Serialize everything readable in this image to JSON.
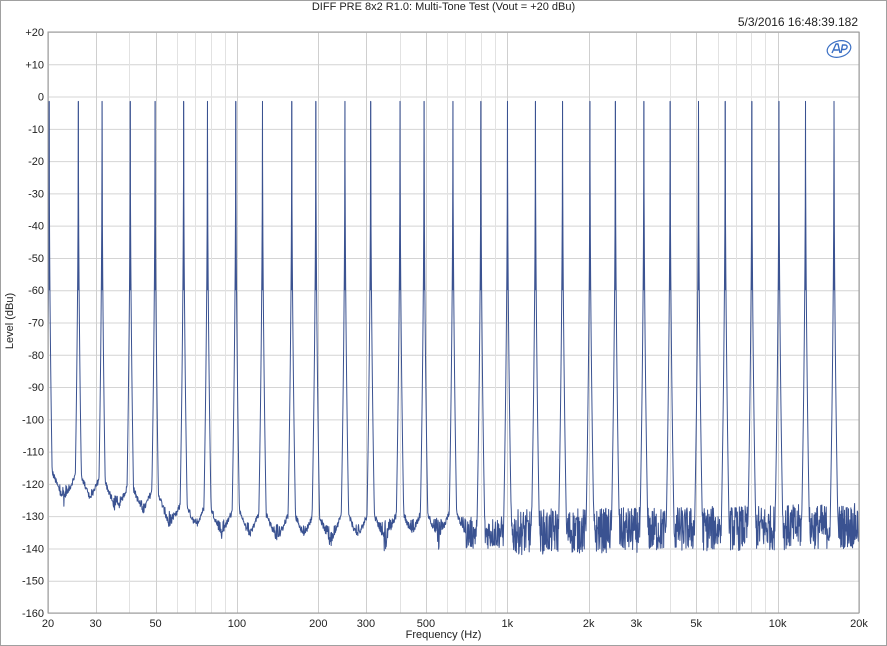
{
  "chart_data": {
    "type": "line",
    "title": "DIFF PRE 8x2 R1.0: Multi-Tone Test (Vout = +20 dBu)",
    "timestamp": "5/3/2016 16:48:39.182",
    "xlabel": "Frequency (Hz)",
    "ylabel": "Level (dBu)",
    "xscale": "log",
    "xlim": [
      20,
      20000
    ],
    "ylim": [
      -160,
      20
    ],
    "grid": true,
    "line_color": "#3a5291",
    "x_ticks": [
      {
        "value": 20,
        "label": "20"
      },
      {
        "value": 30,
        "label": "30"
      },
      {
        "value": 50,
        "label": "50"
      },
      {
        "value": 100,
        "label": "100"
      },
      {
        "value": 200,
        "label": "200"
      },
      {
        "value": 300,
        "label": "300"
      },
      {
        "value": 500,
        "label": "500"
      },
      {
        "value": 1000,
        "label": "1k"
      },
      {
        "value": 2000,
        "label": "2k"
      },
      {
        "value": 3000,
        "label": "3k"
      },
      {
        "value": 5000,
        "label": "5k"
      },
      {
        "value": 10000,
        "label": "10k"
      },
      {
        "value": 20000,
        "label": "20k"
      }
    ],
    "y_ticks": [
      {
        "value": 20,
        "label": "+20"
      },
      {
        "value": 10,
        "label": "+10"
      },
      {
        "value": 0,
        "label": "0"
      },
      {
        "value": -10,
        "label": "-10"
      },
      {
        "value": -20,
        "label": "-20"
      },
      {
        "value": -30,
        "label": "-30"
      },
      {
        "value": -40,
        "label": "-40"
      },
      {
        "value": -50,
        "label": "-50"
      },
      {
        "value": -60,
        "label": "-60"
      },
      {
        "value": -70,
        "label": "-70"
      },
      {
        "value": -80,
        "label": "-80"
      },
      {
        "value": -90,
        "label": "-90"
      },
      {
        "value": -100,
        "label": "-100"
      },
      {
        "value": -110,
        "label": "-110"
      },
      {
        "value": -120,
        "label": "-120"
      },
      {
        "value": -130,
        "label": "-130"
      },
      {
        "value": -140,
        "label": "-140"
      },
      {
        "value": -150,
        "label": "-150"
      },
      {
        "value": -160,
        "label": "-160"
      }
    ],
    "tones_hz": [
      20.2,
      25.9,
      31.7,
      40.3,
      49.8,
      63.5,
      77.8,
      99.0,
      124.3,
      159.5,
      195.8,
      250.9,
      312.4,
      401.1,
      492.3,
      629.5,
      798.5,
      1001.7,
      1271,
      1601,
      2022,
      2511,
      3201,
      4003,
      5097,
      6399,
      8029,
      10113,
      12681,
      16166
    ],
    "tone_level_dbu": -1.5,
    "noise_floor": [
      {
        "x": 20.5,
        "y": -123
      },
      {
        "x": 25,
        "y": -124
      },
      {
        "x": 30,
        "y": -125
      },
      {
        "x": 35,
        "y": -127
      },
      {
        "x": 40,
        "y": -128
      },
      {
        "x": 50,
        "y": -129
      },
      {
        "x": 60,
        "y": -133
      },
      {
        "x": 80,
        "y": -134
      },
      {
        "x": 100,
        "y": -135
      },
      {
        "x": 150,
        "y": -136
      },
      {
        "x": 200,
        "y": -136.5
      },
      {
        "x": 300,
        "y": -136
      },
      {
        "x": 500,
        "y": -135.5
      },
      {
        "x": 1000,
        "y": -135
      },
      {
        "x": 2000,
        "y": -134.5
      },
      {
        "x": 5000,
        "y": -134
      },
      {
        "x": 10000,
        "y": -133.5
      },
      {
        "x": 20000,
        "y": -133
      }
    ]
  }
}
